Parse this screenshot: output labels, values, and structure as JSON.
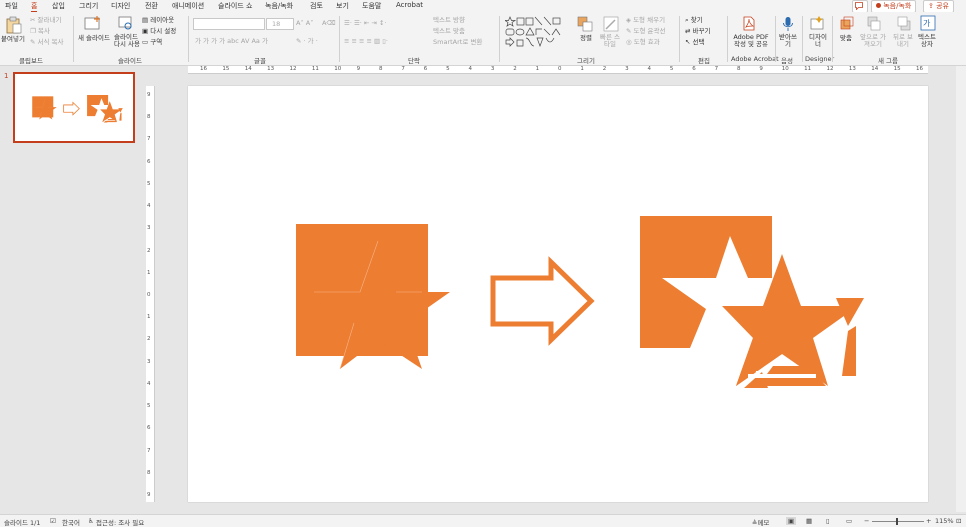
{
  "menu": {
    "tabs": [
      "파일",
      "홈",
      "삽입",
      "그리기",
      "디자인",
      "전환",
      "애니메이션",
      "슬라이드 쇼",
      "녹음/녹화",
      "검토",
      "보기",
      "도움말",
      "Acrobat"
    ],
    "active_tab": "홈",
    "comment_btn": "",
    "record_btn": "녹음/녹화",
    "share_btn": "공유"
  },
  "ribbon": {
    "clipboard": {
      "paste": "붙여넣기",
      "cut": "잘라내기",
      "copy": "복사",
      "format_painter": "서식 복사",
      "label": "클립보드"
    },
    "slides": {
      "new_slide": "새 슬라이드",
      "reuse": "슬라이드 다시 사용",
      "layout": "레이아웃",
      "reset": "다시 설정",
      "section": "구역",
      "label": "슬라이드"
    },
    "font": {
      "font_size": "18",
      "label": "글꼴",
      "buttons": [
        "가",
        "가",
        "가",
        "가",
        "abc",
        "AV",
        "Aa",
        "가"
      ]
    },
    "paragraph": {
      "label": "단락",
      "text_direction": "텍스트 방향",
      "align_text": "텍스트 맞춤",
      "smartart": "SmartArt로 변환"
    },
    "drawing": {
      "arrange": "정렬",
      "quick_styles": "빠른 스타일",
      "shape_fill": "도형 채우기",
      "shape_outline": "도형 윤곽선",
      "shape_effects": "도형 효과",
      "label": "그리기"
    },
    "editing": {
      "find": "찾기",
      "replace": "바꾸기",
      "select": "선택",
      "label": "편집"
    },
    "acrobat": {
      "create_pdf": "Adobe PDF 작성 및 공유",
      "label": "Adobe Acrobat"
    },
    "voice": {
      "dictate": "받아쓰기",
      "label": "음성"
    },
    "designer": {
      "design_ideas": "디자이너",
      "label": "Designer"
    },
    "new_group": {
      "fit": "맞춤",
      "send_back": "앞으로 가져오기",
      "bring_front": "뒤로 보내기",
      "text_box": "텍스트 상자",
      "label": "새 그룹"
    }
  },
  "ruler": {
    "h_ticks": [
      "16",
      "15",
      "14",
      "13",
      "12",
      "11",
      "10",
      "9",
      "8",
      "7",
      "6",
      "5",
      "4",
      "3",
      "2",
      "1",
      "0",
      "1",
      "2",
      "3",
      "4",
      "5",
      "6",
      "7",
      "8",
      "9",
      "10",
      "11",
      "12",
      "13",
      "14",
      "15",
      "16"
    ],
    "v_ticks": [
      "9",
      "8",
      "7",
      "6",
      "5",
      "4",
      "3",
      "2",
      "1",
      "0",
      "1",
      "2",
      "3",
      "4",
      "5",
      "6",
      "7",
      "8",
      "9"
    ]
  },
  "thumbnails": [
    {
      "number": "1"
    }
  ],
  "slide": {
    "colors": {
      "orange": "#ed7d31",
      "white": "#ffffff"
    },
    "shapes": [
      "square-star-union",
      "right-arrow-outline",
      "square-star-subtract"
    ]
  },
  "status": {
    "slide_counter": "슬라이드 1/1",
    "language": "한국어",
    "accessibility": "접근성: 조사 필요",
    "notes": "메모",
    "zoom": "115%"
  }
}
